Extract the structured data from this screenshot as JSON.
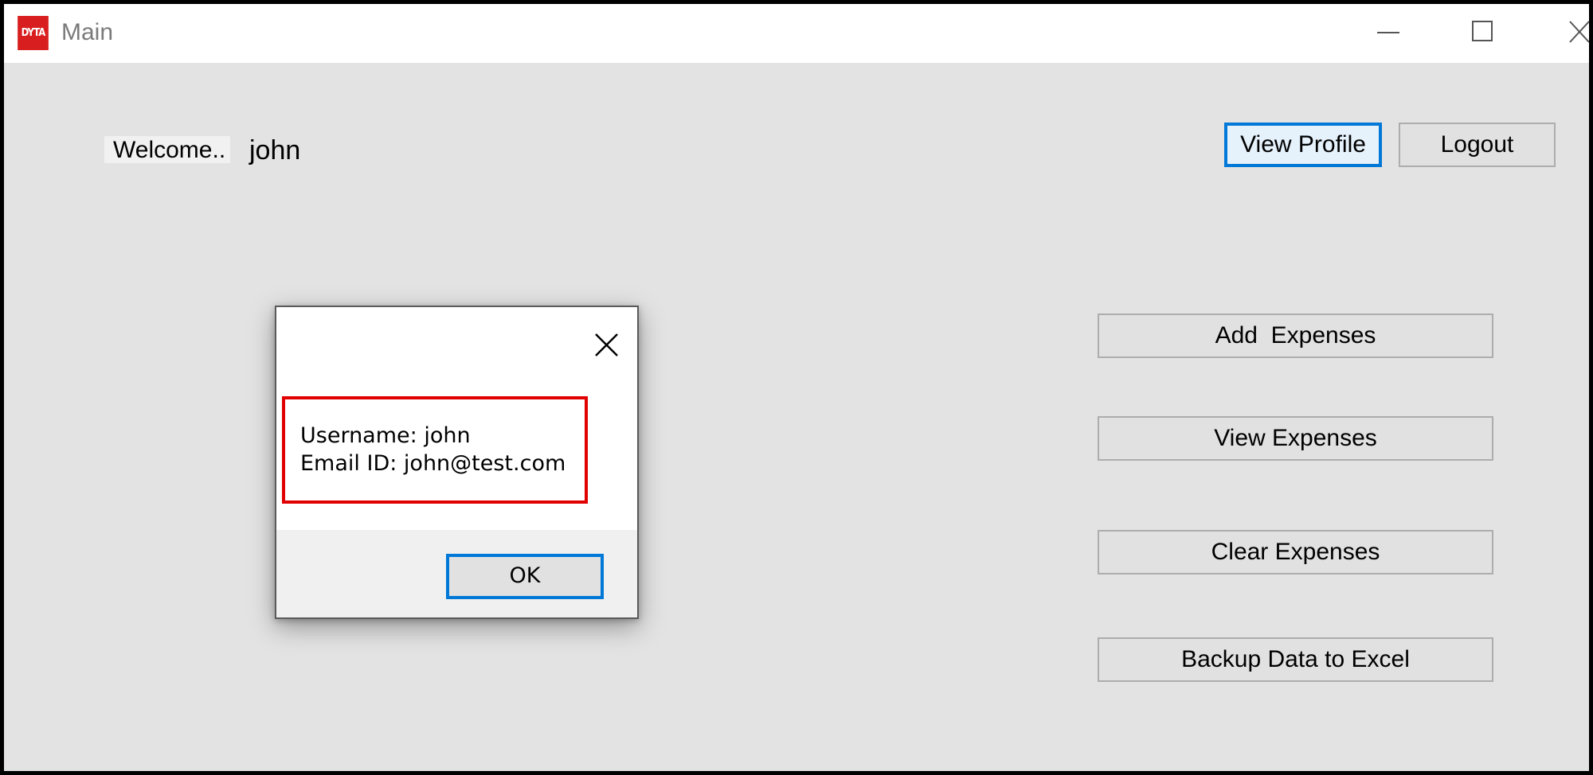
{
  "window": {
    "app_icon_text": "DYTA",
    "title": "Main",
    "controls": {
      "minimize_icon": "minimize-icon",
      "maximize_icon": "maximize-icon",
      "close_icon": "close-icon"
    }
  },
  "main": {
    "welcome_label": "Welcome..",
    "username": "john",
    "buttons": {
      "view_profile": "View Profile",
      "logout": "Logout",
      "add_expenses": "Add  Expenses",
      "view_expenses": "View Expenses",
      "clear_expenses": "Clear Expenses",
      "backup": "Backup Data to Excel"
    }
  },
  "dialog": {
    "close_icon": "close-icon",
    "message_line_1": "Username: john",
    "message_line_2": "Email ID: john@test.com",
    "ok_label": "OK"
  },
  "colors": {
    "focus_accent": "#0078d7",
    "highlight_border": "#e00000",
    "app_icon_bg": "#d81e1e",
    "client_bg": "#e3e3e3"
  }
}
